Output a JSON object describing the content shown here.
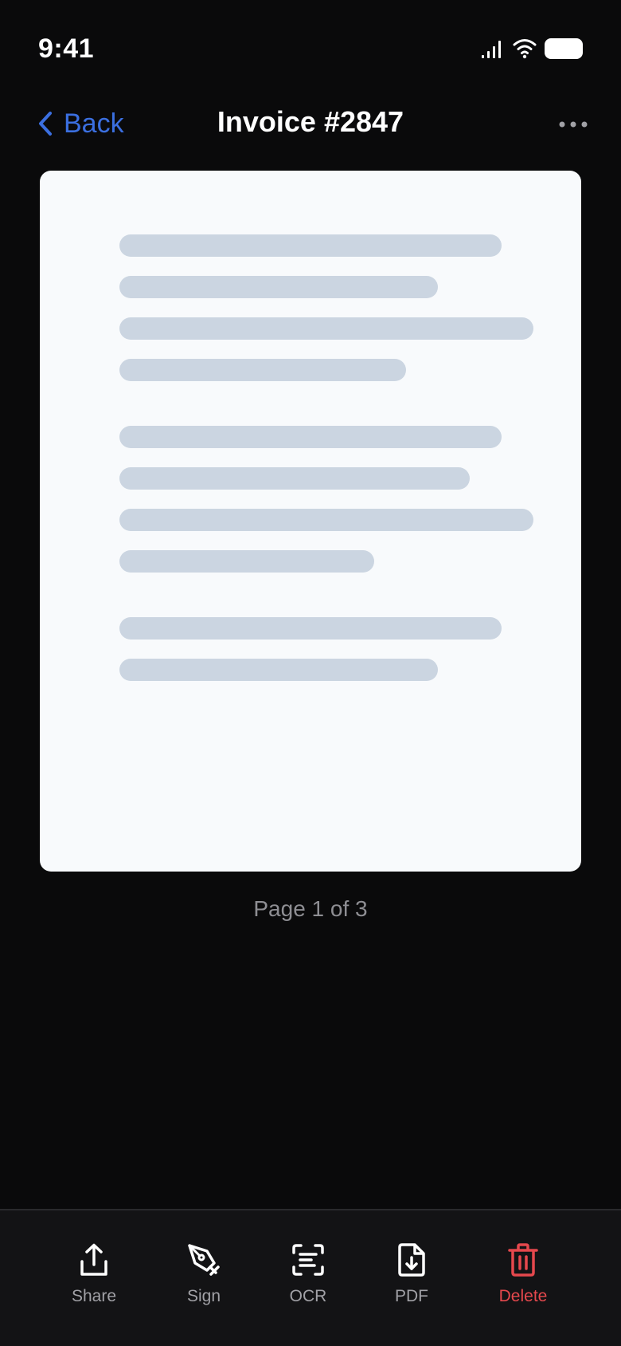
{
  "status_bar": {
    "time": "9:41",
    "icons": [
      "signal-icon",
      "wifi-icon",
      "battery-icon"
    ]
  },
  "nav": {
    "back_label": "Back",
    "title": "Invoice #2847",
    "more_icon": "more-horizontal-icon"
  },
  "document": {
    "page_indicator": "Page 1 of 3"
  },
  "toolbar": {
    "items": [
      {
        "label": "Share",
        "icon": "share-icon"
      },
      {
        "label": "Sign",
        "icon": "pen-sign-icon"
      },
      {
        "label": "OCR",
        "icon": "scan-text-icon"
      },
      {
        "label": "PDF",
        "icon": "file-download-icon"
      },
      {
        "label": "Delete",
        "icon": "trash-icon"
      }
    ]
  },
  "colors": {
    "background": "#0a0a0b",
    "accent": "#3b6fe0",
    "danger": "#e5484d",
    "card": "#f8fafc",
    "placeholder_line": "#cbd5e1",
    "muted_text": "#8e8e93"
  }
}
